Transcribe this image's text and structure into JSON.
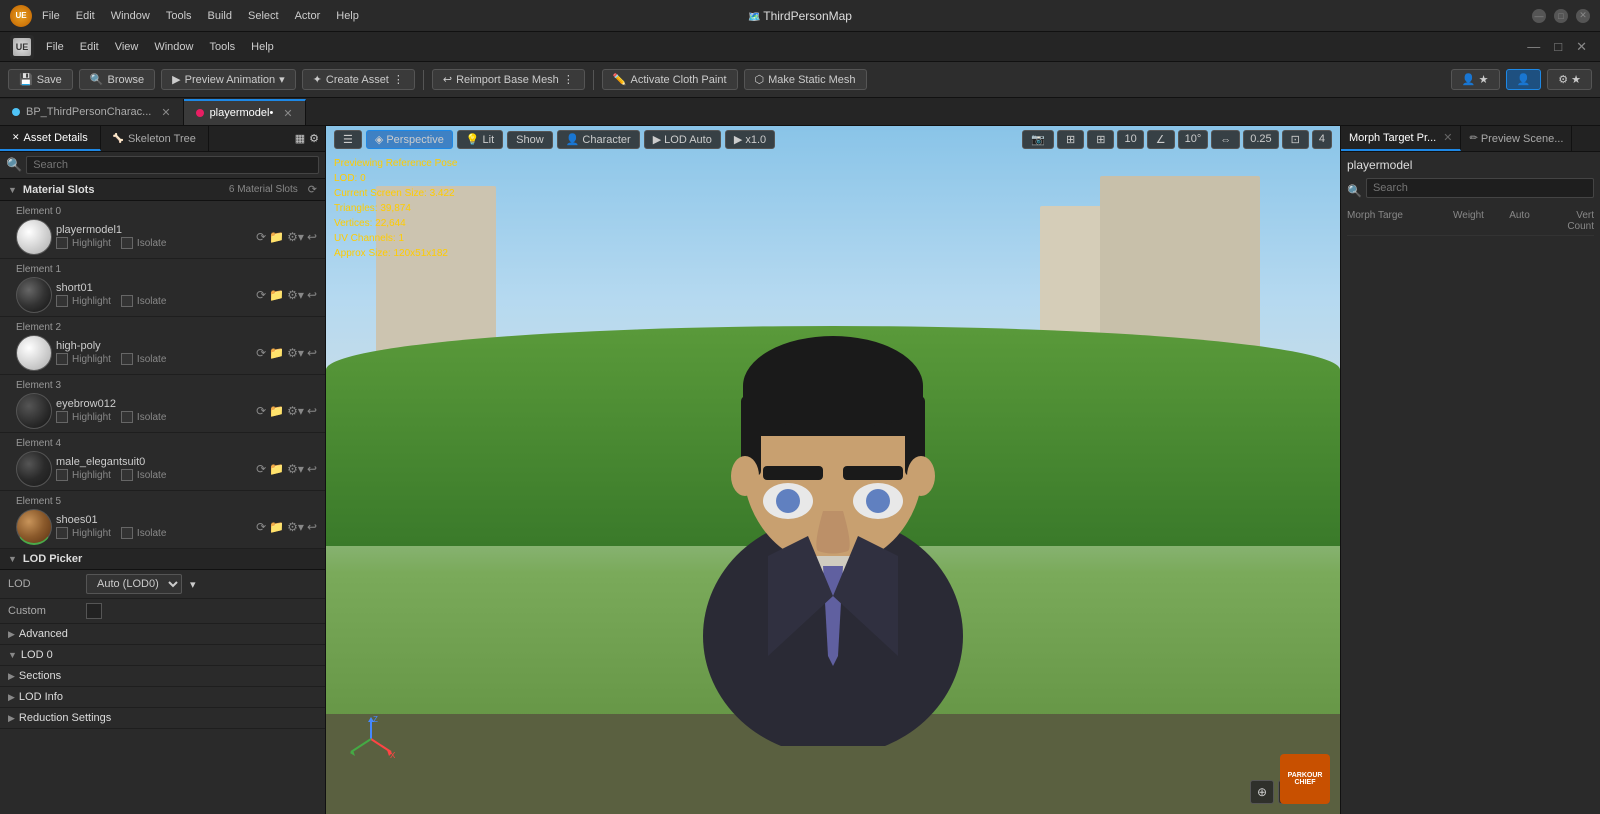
{
  "titlebar": {
    "app_name": "ParkourChief",
    "os_icon": "UE",
    "menu_items": [
      "File",
      "Edit",
      "Window",
      "Tools",
      "Build",
      "Select",
      "Actor",
      "Help"
    ],
    "map_name": "ThirdPersonMap"
  },
  "appbar": {
    "menu_items": [
      "File",
      "Edit",
      "View",
      "Window",
      "Tools",
      "Help"
    ]
  },
  "toolbar": {
    "save_label": "Save",
    "browse_label": "Browse",
    "preview_anim_label": "Preview Animation",
    "create_asset_label": "Create Asset",
    "reimport_label": "Reimport Base Mesh",
    "cloth_paint_label": "Activate Cloth Paint",
    "static_mesh_label": "Make Static Mesh"
  },
  "tabs": [
    {
      "name": "BP_ThirdPersonCharac...",
      "color": "#4fc3f7",
      "active": false
    },
    {
      "name": "playermodel•",
      "color": "#e91e63",
      "active": true
    }
  ],
  "left_panel": {
    "panel_tabs": [
      {
        "label": "Asset Details",
        "active": true
      },
      {
        "label": "Skeleton Tree",
        "active": false
      }
    ],
    "search_placeholder": "Search",
    "material_slots_section": {
      "label": "Material Slots",
      "slot_count": "6 Material Slots",
      "elements": [
        {
          "name": "Element 0",
          "material": "playermodel1",
          "sphere_class": "thumb-sphere-white"
        },
        {
          "name": "Element 1",
          "material": "short01",
          "sphere_class": "thumb-sphere-black"
        },
        {
          "name": "Element 2",
          "material": "high-poly",
          "sphere_class": "thumb-sphere-white"
        },
        {
          "name": "Element 3",
          "material": "eyebrow012",
          "sphere_class": "thumb-sphere-dark"
        },
        {
          "name": "Element 4",
          "material": "male_elegantsuit0",
          "sphere_class": "thumb-sphere-suit"
        },
        {
          "name": "Element 5",
          "material": "shoes01",
          "sphere_class": "thumb-sphere-brown"
        }
      ]
    },
    "lod_picker": {
      "label": "LOD Picker",
      "lod_label": "LOD",
      "lod_value": "Auto (LOD0)",
      "custom_label": "Custom"
    },
    "advanced_label": "Advanced",
    "lod0_label": "LOD 0",
    "sections_label": "Sections",
    "lod_info_label": "LOD Info",
    "reduction_label": "Reduction Settings"
  },
  "viewport": {
    "info": {
      "line1": "Previewing Reference Pose",
      "line2": "LOD: 0",
      "line3": "Current Screen Size: 3.422",
      "line4": "Triangles: 39,874",
      "line5": "Vertices: 22,644",
      "line6": "UV Channels: 1",
      "line7": "Approx Size: 120x51x182"
    },
    "toolbar": {
      "perspective_label": "Perspective",
      "lit_label": "Lit",
      "show_label": "Show",
      "character_label": "Character",
      "lod_auto_label": "LOD Auto",
      "play_speed": "x1.0",
      "grid_num": "10",
      "angle_num": "10°",
      "scale_num": "0.25",
      "view_num": "4"
    }
  },
  "right_panel": {
    "tabs": [
      {
        "label": "Morph Target Pr...",
        "active": true
      },
      {
        "label": "Preview Scene...",
        "active": false
      }
    ],
    "title": "playermodel",
    "search_placeholder": "Search",
    "columns": {
      "name": "Morph Targe",
      "weight": "Weight",
      "auto": "Auto",
      "vert_count": "Vert Count"
    }
  },
  "overlay_badge": {
    "line1": "PARKOUR",
    "line2": "CHIEF"
  }
}
